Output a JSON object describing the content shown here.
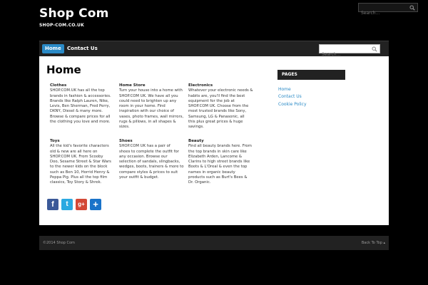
{
  "site": {
    "title": "Shop Com",
    "description": "SHOP-COM.CO.UK"
  },
  "top_search": {
    "placeholder": "Search..."
  },
  "nav": {
    "items": [
      {
        "label": "Home",
        "active": true
      },
      {
        "label": "Contact Us",
        "active": false
      }
    ],
    "search_placeholder": "Search..."
  },
  "main": {
    "title": "Home",
    "categories": [
      {
        "title": "Clothes",
        "lines": [
          "SHOP.COM.UK has all the top",
          "brands in fashion & accessories.",
          "Brands like Ralph Lauren, Nike,",
          "Levis, Ben Sherman, Fred Perry,",
          "DKNY, Diesel & many more.",
          "Browse & compare prices for all",
          "the clothing you love and more."
        ]
      },
      {
        "title": "Home Store",
        "lines": [
          "Turn your house into a home with",
          "SHOP.COM UK. We have all you",
          "could need to brighten up any",
          "room in your home. Find",
          "inspiration with our choice of",
          "vases, photo frames, wall mirrors,",
          "rugs & pillows, in all shapes &",
          "sizes."
        ]
      },
      {
        "title": "Electronics",
        "lines": [
          "Whatever your electronic needs &",
          "habits are, you'll find the best",
          "equipment for the job at",
          "SHOP.COM UK. Choose from the",
          "most trusted brands like Sony,",
          "Samsung, LG & Panasonic, all",
          "this plus great prices & huge",
          "savings."
        ]
      },
      {
        "title": "Toys",
        "lines": [
          "All the kid's favorite characters",
          "old & new are all here on",
          "SHOP.COM UK. From Scooby",
          "Doo, Sesame Street & Star Wars",
          "to the newer kids on the block",
          "such as Ben 10, Horrid Henry &",
          "Peppa Pig. Plus all the top film",
          "classics, Toy Story & Shrek."
        ]
      },
      {
        "title": "Shoes",
        "lines": [
          "SHOP.COM UK has a pair of",
          "shoes to complete the outfit for",
          "any occasion. Browse our",
          "selection of sandals, slingbacks,",
          "wedges, boots, trainers & more to",
          "compare styles & prices to suit",
          "your outfit & budget."
        ]
      },
      {
        "title": "Beauty",
        "lines": [
          "Find all beauty brands here. From",
          "the top brands in skin care like",
          "Elizabeth Arden, Lancome &",
          "Clarins to high street brands like",
          "Boots & L'Oreal & even the top",
          "names in organic beauty",
          "products such as Burt's Bees &",
          "Dr. Organic."
        ]
      }
    ],
    "social": [
      {
        "name": "facebook",
        "glyph": "f",
        "color": "#3b5998"
      },
      {
        "name": "twitter",
        "glyph": "t",
        "color": "#2ba9e1"
      },
      {
        "name": "google-plus",
        "glyph": "g+",
        "color": "#d34836"
      },
      {
        "name": "share",
        "glyph": "+",
        "color": "#1a73c9"
      }
    ]
  },
  "sidebar": {
    "heading": "PAGES",
    "links": [
      "Home",
      "Contact Us",
      "Cookie Policy"
    ]
  },
  "footer": {
    "copyright": "©2014 Shop Com",
    "back_to_top": "Back To Top ▴"
  }
}
